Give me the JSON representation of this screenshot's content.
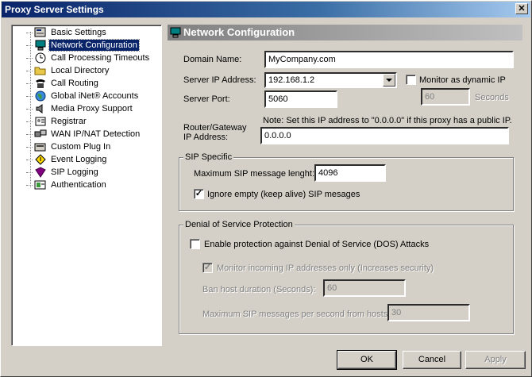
{
  "window": {
    "title": "Proxy Server Settings",
    "close_glyph": "✕"
  },
  "tree": {
    "items": [
      {
        "label": "Basic Settings",
        "icon": "settings-icon"
      },
      {
        "label": "Network Configuration",
        "icon": "network-icon",
        "selected": true
      },
      {
        "label": "Call Processing Timeouts",
        "icon": "clock-icon"
      },
      {
        "label": "Local Directory",
        "icon": "folder-icon"
      },
      {
        "label": "Call Routing",
        "icon": "phone-icon"
      },
      {
        "label": "Global iNet® Accounts",
        "icon": "globe-icon"
      },
      {
        "label": "Media Proxy Support",
        "icon": "speaker-icon"
      },
      {
        "label": "Registrar",
        "icon": "registrar-icon"
      },
      {
        "label": "WAN IP/NAT Detection",
        "icon": "wan-icon"
      },
      {
        "label": "Custom Plug In",
        "icon": "plugin-icon"
      },
      {
        "label": "Event Logging",
        "icon": "event-icon"
      },
      {
        "label": "SIP Logging",
        "icon": "book-icon"
      },
      {
        "label": "Authentication",
        "icon": "auth-icon"
      }
    ]
  },
  "panel": {
    "title": "Network Configuration",
    "domain_name": {
      "label": "Domain Name:",
      "value": "MyCompany.com"
    },
    "server_ip": {
      "label": "Server IP Address:",
      "value": "192.168.1.2"
    },
    "monitor_dynamic": {
      "label": "Monitor as dynamic IP",
      "checked": false
    },
    "monitor_seconds": {
      "value": "60",
      "unit": "Seconds"
    },
    "server_port": {
      "label": "Server Port:",
      "value": "5060"
    },
    "router_gateway": {
      "label_line1": "Router/Gateway",
      "label_line2": "IP Address:",
      "note": "Note: Set this IP address to \"0.0.0.0\" if this proxy has a public IP.",
      "value": "0.0.0.0"
    },
    "sip_specific": {
      "title": "SIP Specific",
      "max_len_label": "Maximum SIP message lenght:",
      "max_len_value": "4096",
      "ignore_label": "Ignore empty (keep alive) SIP mesages",
      "ignore_checked": true
    },
    "dos": {
      "title": "Denial of Service Protection",
      "enable_label": "Enable protection against Denial of Service (DOS) Attacks",
      "enable_checked": false,
      "monitor_label": "Monitor incoming IP addresses only (Increases security)",
      "monitor_checked": true,
      "ban_label": "Ban host duration (Seconds):",
      "ban_value": "60",
      "max_msgs_label": "Maximum SIP messages per second from hosts:",
      "max_msgs_value": "30"
    }
  },
  "buttons": {
    "ok": "OK",
    "cancel": "Cancel",
    "apply": "Apply"
  },
  "check_glyph": "✓"
}
